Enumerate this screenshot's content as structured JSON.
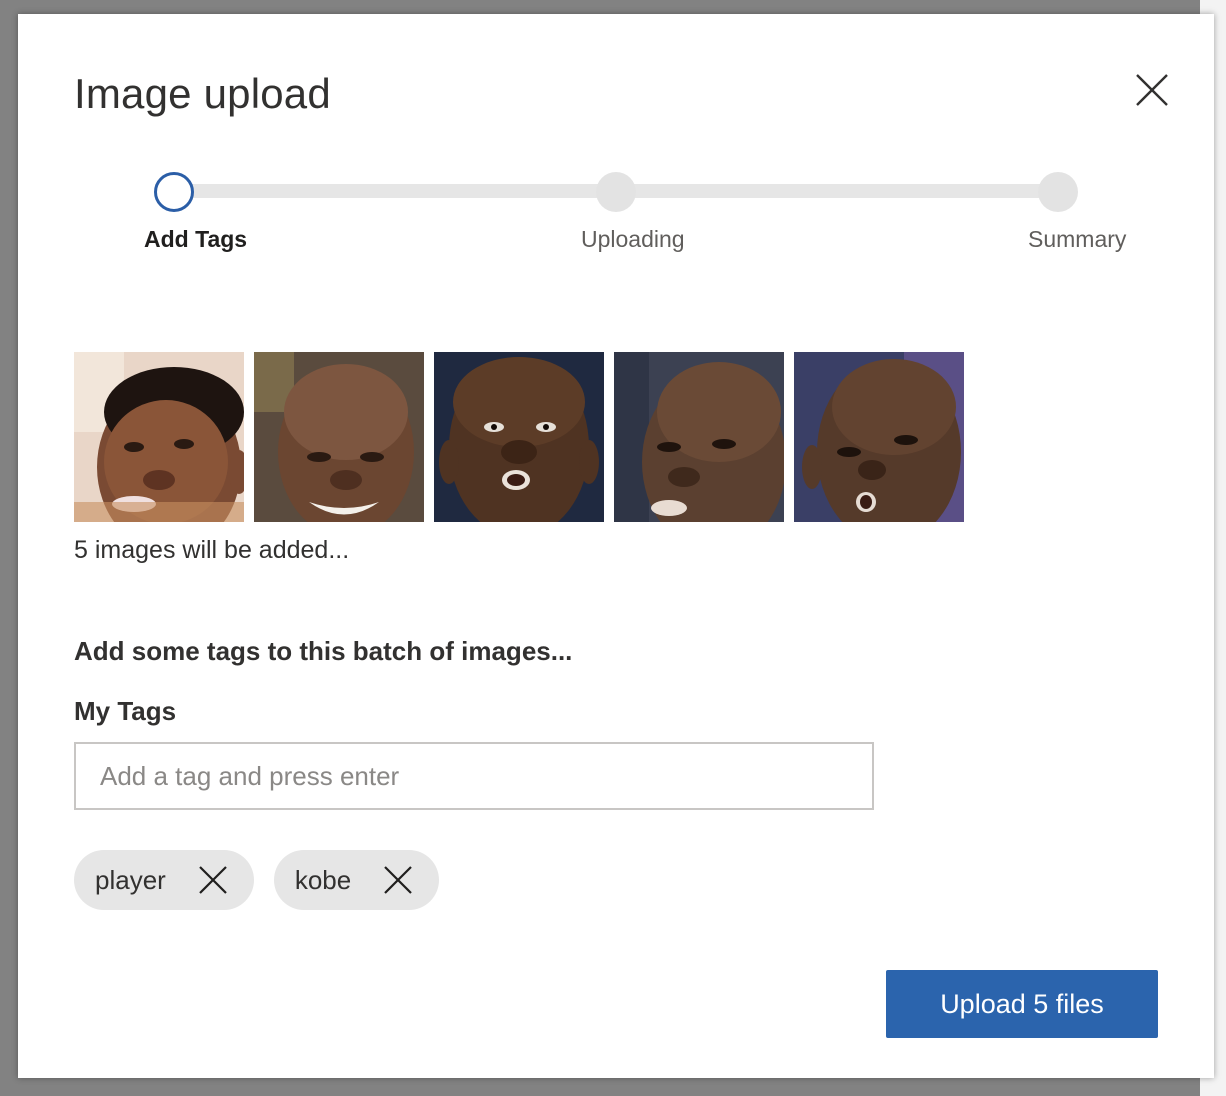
{
  "dialog": {
    "title": "Image upload",
    "close_icon": "close-icon"
  },
  "stepper": {
    "steps": [
      {
        "label": "Add Tags",
        "state": "active"
      },
      {
        "label": "Uploading",
        "state": "pending"
      },
      {
        "label": "Summary",
        "state": "pending"
      }
    ]
  },
  "images": {
    "thumbnails": [
      {
        "name": "face-photo-1"
      },
      {
        "name": "face-photo-2"
      },
      {
        "name": "face-photo-3"
      },
      {
        "name": "face-photo-4"
      },
      {
        "name": "face-photo-5"
      }
    ],
    "count_text": "5 images will be added..."
  },
  "tags_section": {
    "heading": "Add some tags to this batch of images...",
    "field_label": "My Tags",
    "input_placeholder": "Add a tag and press enter",
    "input_value": "",
    "tags": [
      {
        "label": "player"
      },
      {
        "label": "kobe"
      }
    ]
  },
  "footer": {
    "upload_button_label": "Upload 5 files"
  },
  "colors": {
    "accent": "#2b64ad",
    "step_active_border": "#2b5ea7",
    "step_inactive": "#e3e3e3",
    "tag_background": "#e6e6e6"
  }
}
